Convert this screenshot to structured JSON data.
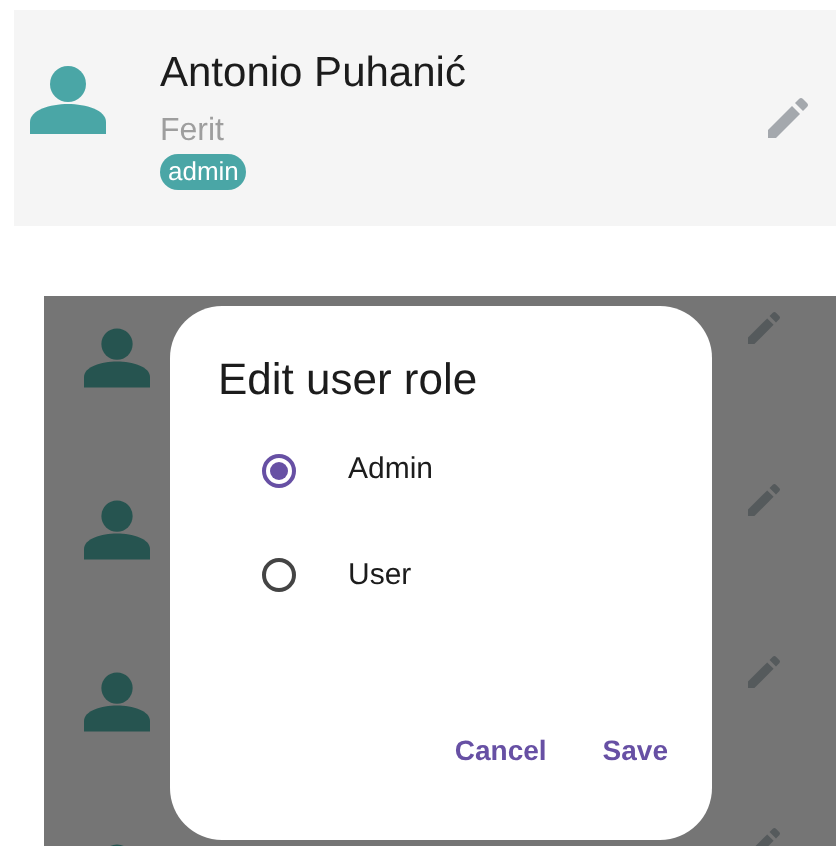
{
  "user_card": {
    "name": "Antonio Puhanić",
    "organization": "Ferit",
    "role_badge": "admin"
  },
  "dialog": {
    "title": "Edit user role",
    "options": [
      {
        "label": "Admin",
        "selected": true
      },
      {
        "label": "User",
        "selected": false
      }
    ],
    "buttons": [
      "Cancel",
      "Save"
    ]
  }
}
